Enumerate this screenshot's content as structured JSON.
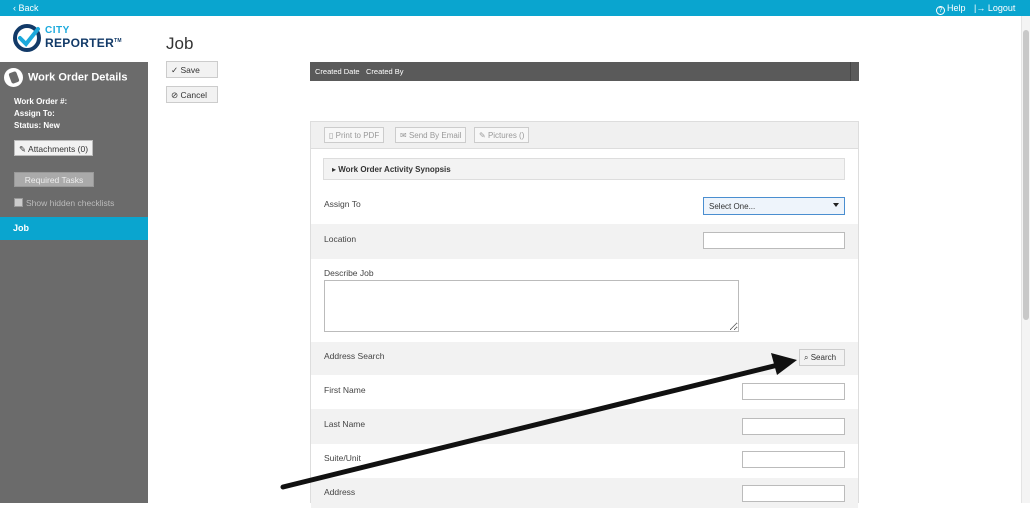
{
  "topbar": {
    "back": "Back",
    "help": "Help",
    "logout": "Logout",
    "color": "#0aa5cf"
  },
  "logo": {
    "line1": "CITY",
    "line2": "REPORTER",
    "tm": "TM"
  },
  "sidebar": {
    "title": "Work Order Details",
    "work_order": "Work Order #:",
    "assign_to": "Assign To:",
    "status": "Status: New",
    "attachments": "Attachments (0)",
    "required_tasks": "Required Tasks",
    "show_hidden": "Show hidden checklists",
    "nav_job": "Job"
  },
  "main": {
    "title": "Job",
    "save": "Save",
    "cancel": "Cancel",
    "columns": [
      "Created Date",
      "Created By"
    ],
    "toolbar": {
      "print": "Print to PDF",
      "email": "Send By Email",
      "pictures": "Pictures ()"
    },
    "synopsis": "Work Order Activity Synopsis",
    "assign_to": "Assign To",
    "assign_select": "Select One...",
    "location": "Location",
    "describe_job": "Describe Job",
    "address_search": "Address Search",
    "search": "Search",
    "first_name": "First Name",
    "last_name": "Last Name",
    "suite_unit": "Suite/Unit",
    "address": "Address"
  }
}
